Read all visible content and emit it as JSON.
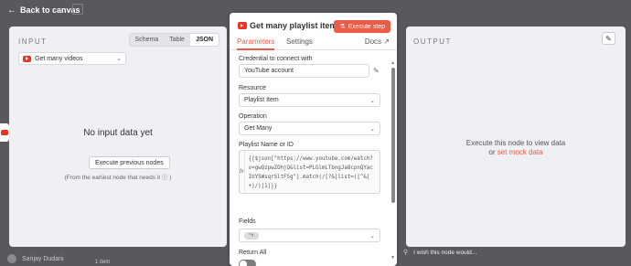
{
  "topbar": {
    "back_label": "Back to canvas"
  },
  "footer": {
    "user_name": "Sanjay Dudani",
    "canvas_text": "1 item",
    "wish_text": "I wish this node would..."
  },
  "input_panel": {
    "label": "INPUT",
    "view_tabs": [
      "Schema",
      "Table",
      "JSON"
    ],
    "active_view": "JSON",
    "node_select": "Get many videos",
    "empty_title": "No input data yet",
    "execute_previous_label": "Execute previous nodes",
    "hint": "(From the earliest node that needs it ⓘ )"
  },
  "node_panel": {
    "title": "Get many playlist items",
    "execute_label": "Execute step",
    "tabs": {
      "parameters": "Parameters",
      "settings": "Settings",
      "docs": "Docs"
    },
    "credential": {
      "label": "Credential to connect with",
      "value": "YouTube account"
    },
    "resource": {
      "label": "Resource",
      "value": "Playlist Item"
    },
    "operation": {
      "label": "Operation",
      "value": "Get Many"
    },
    "playlist": {
      "label": "Playlist Name or ID",
      "fx": "fx",
      "value": "{{$json[\"https://www.youtube.com/watch?v=gwQzpwZOhjQ&list=PLGlmLTbngJa8cpnQYacIUYSWsqrSltFSg\"].match(/[?&]list=([^&]+)/)[1]}}"
    },
    "fields": {
      "label": "Fields",
      "pill": "*"
    },
    "return_all": {
      "label": "Return All",
      "value": false
    }
  },
  "output_panel": {
    "label": "OUTPUT",
    "message_line1": "Execute this node to view data",
    "message_or": "or",
    "message_link": "set mock data"
  },
  "colors": {
    "accent": "#ea5c48",
    "youtube": "#ee3322"
  }
}
